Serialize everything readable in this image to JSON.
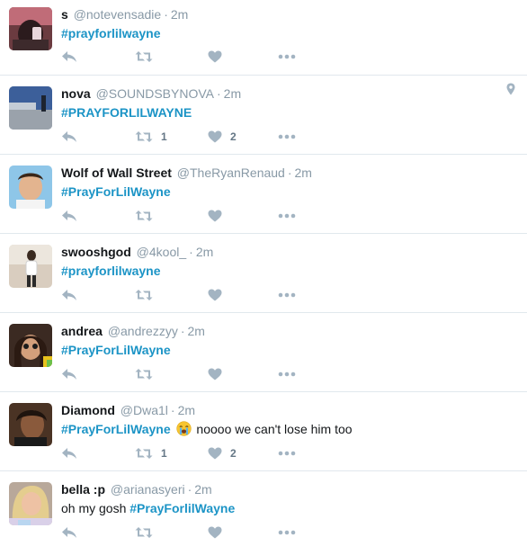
{
  "colors": {
    "hashtag": "#1c94c6",
    "meta": "#8899a6",
    "icon": "#a3b4c2",
    "divider": "#e1e8ed"
  },
  "tweets": [
    {
      "name": "s",
      "handle": "@notevensadie",
      "time": "2m",
      "text_before": "",
      "hashtag": "#prayforlilwayne",
      "text_after": "",
      "emoji": "",
      "retweets": "",
      "likes": ""
    },
    {
      "name": "nova",
      "handle": "@SOUNDSBYNOVA",
      "time": "2m",
      "text_before": "",
      "hashtag": "#PRAYFORLILWAYNE",
      "text_after": "",
      "emoji": "",
      "retweets": "1",
      "likes": "2",
      "geo": "location-pin-icon"
    },
    {
      "name": "Wolf of Wall Street",
      "handle": "@TheRyanRenaud",
      "time": "2m",
      "text_before": "",
      "hashtag": "#PrayForLilWayne",
      "text_after": "",
      "emoji": "",
      "retweets": "",
      "likes": ""
    },
    {
      "name": "swooshgod",
      "handle": "@4kool_",
      "time": "2m",
      "text_before": "",
      "hashtag": "#prayforlilwayne",
      "text_after": "",
      "emoji": "",
      "retweets": "",
      "likes": ""
    },
    {
      "name": "andrea",
      "handle": "@andrezzyy",
      "time": "2m",
      "text_before": "",
      "hashtag": "#PrayForLilWayne",
      "text_after": "",
      "emoji": "",
      "retweets": "",
      "likes": ""
    },
    {
      "name": "Diamond",
      "handle": "@Dwa1l",
      "time": "2m",
      "text_before": "",
      "hashtag": "#PrayForLilWayne",
      "text_after": "noooo we can't lose him too",
      "emoji": "loudly-crying-face-emoji",
      "retweets": "1",
      "likes": "2"
    },
    {
      "name": "bella :p",
      "handle": "@arianasyeri",
      "time": "2m",
      "text_before": "oh my gosh ",
      "hashtag": "#PrayForlilWayne",
      "text_after": "",
      "emoji": "",
      "retweets": "",
      "likes": ""
    }
  ]
}
